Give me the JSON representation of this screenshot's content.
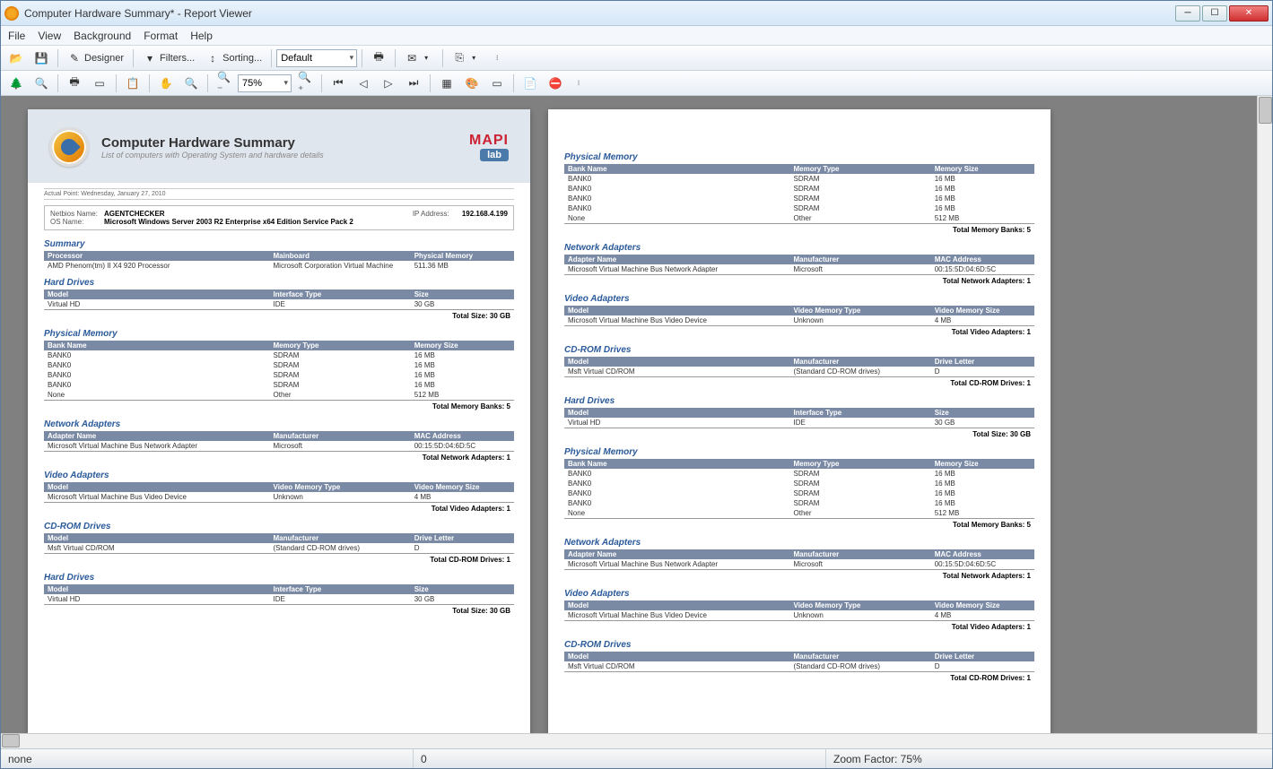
{
  "window": {
    "title": "Computer Hardware Summary* - Report Viewer"
  },
  "menu": {
    "file": "File",
    "view": "View",
    "background": "Background",
    "format": "Format",
    "help": "Help"
  },
  "toolbar1": {
    "designer": "Designer",
    "filters": "Filters...",
    "sorting": "Sorting...",
    "style_combo": "Default"
  },
  "toolbar2": {
    "zoom_combo": "75%"
  },
  "report": {
    "title": "Computer Hardware Summary",
    "subtitle": "List of computers with Operating System and hardware details",
    "actual_point": "Actual Point: Wednesday, January 27, 2010",
    "netbios_label": "Netbios Name:",
    "netbios_value": "AGENTCHECKER",
    "ipaddr_label": "IP Address:",
    "ipaddr_value": "192.168.4.199",
    "osname_label": "OS Name:",
    "osname_value": "Microsoft Windows Server 2003 R2 Enterprise x64 Edition Service Pack 2",
    "sections": {
      "summary": {
        "title": "Summary",
        "headers": [
          "Processor",
          "Mainboard",
          "Physical Memory"
        ],
        "rows": [
          [
            "AMD Phenom(tm) II X4 920 Processor",
            "Microsoft Corporation Virtual Machine",
            "511.36 MB"
          ]
        ]
      },
      "hard_drives": {
        "title": "Hard Drives",
        "headers": [
          "Model",
          "Interface Type",
          "Size"
        ],
        "rows": [
          [
            "Virtual HD",
            "IDE",
            "30 GB"
          ]
        ],
        "total": "Total Size: 30 GB"
      },
      "physical_memory": {
        "title": "Physical Memory",
        "headers": [
          "Bank Name",
          "Memory Type",
          "Memory Size"
        ],
        "rows": [
          [
            "BANK0",
            "SDRAM",
            "16 MB"
          ],
          [
            "BANK0",
            "SDRAM",
            "16 MB"
          ],
          [
            "BANK0",
            "SDRAM",
            "16 MB"
          ],
          [
            "BANK0",
            "SDRAM",
            "16 MB"
          ],
          [
            "None",
            "Other",
            "512 MB"
          ]
        ],
        "total": "Total Memory Banks: 5"
      },
      "network_adapters": {
        "title": "Network Adapters",
        "headers": [
          "Adapter Name",
          "Manufacturer",
          "MAC Address"
        ],
        "rows": [
          [
            "Microsoft Virtual Machine Bus Network Adapter",
            "Microsoft",
            "00:15:5D:04:6D:5C"
          ]
        ],
        "total": "Total Network Adapters: 1"
      },
      "video_adapters": {
        "title": "Video Adapters",
        "headers": [
          "Model",
          "Video Memory Type",
          "Video Memory Size"
        ],
        "rows": [
          [
            "Microsoft Virtual Machine Bus Video Device",
            "Unknown",
            "4 MB"
          ]
        ],
        "total": "Total Video Adapters: 1"
      },
      "cdrom": {
        "title": "CD-ROM Drives",
        "headers": [
          "Model",
          "Manufacturer",
          "Drive Letter"
        ],
        "rows": [
          [
            "Msft Virtual CD/ROM",
            "(Standard CD-ROM drives)",
            "D"
          ]
        ],
        "total": "Total CD-ROM Drives: 1"
      }
    }
  },
  "status": {
    "left": "none",
    "mid": "0",
    "right": "Zoom Factor: 75%"
  }
}
